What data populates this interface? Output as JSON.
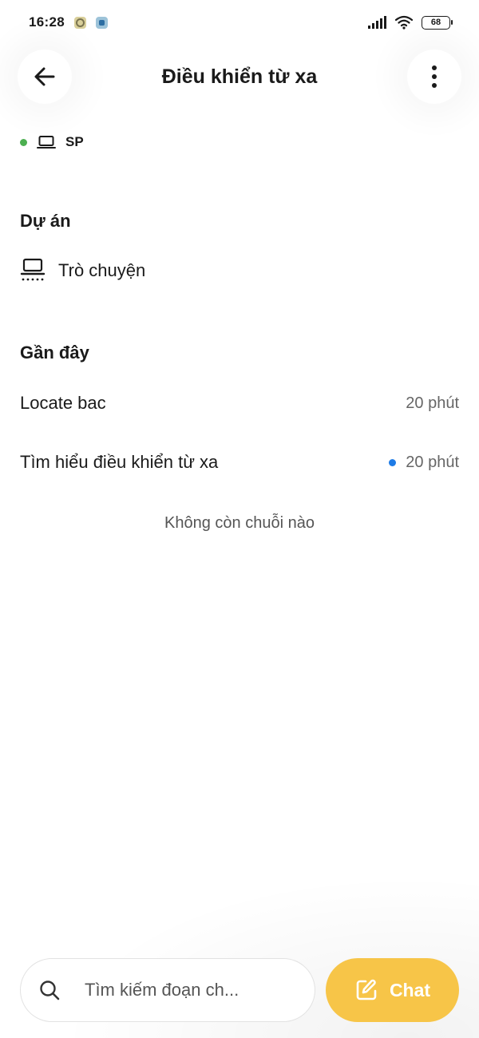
{
  "status_bar": {
    "time": "16:28",
    "battery": "68"
  },
  "header": {
    "title": "Điều khiển từ xa",
    "back_icon": "arrow-left-icon",
    "more_icon": "more-vertical-icon"
  },
  "device": {
    "status_color": "#4caf50",
    "icon": "laptop-icon",
    "name": "SP"
  },
  "projects": {
    "title": "Dự án",
    "items": [
      {
        "icon": "laptop-sparkle-icon",
        "label": "Trò chuyện"
      }
    ]
  },
  "recent": {
    "title": "Gần đây",
    "items": [
      {
        "label": "Locate bac",
        "time": "20 phút",
        "unread": false
      },
      {
        "label": "Tìm hiểu điều khiển từ xa",
        "time": "20 phút",
        "unread": true
      }
    ],
    "empty_text": "Không còn chuỗi nào"
  },
  "bottom": {
    "search_placeholder": "Tìm kiếm đoạn ch...",
    "search_icon": "search-icon",
    "chat_label": "Chat",
    "chat_icon": "edit-icon",
    "accent_color": "#f7c548"
  }
}
